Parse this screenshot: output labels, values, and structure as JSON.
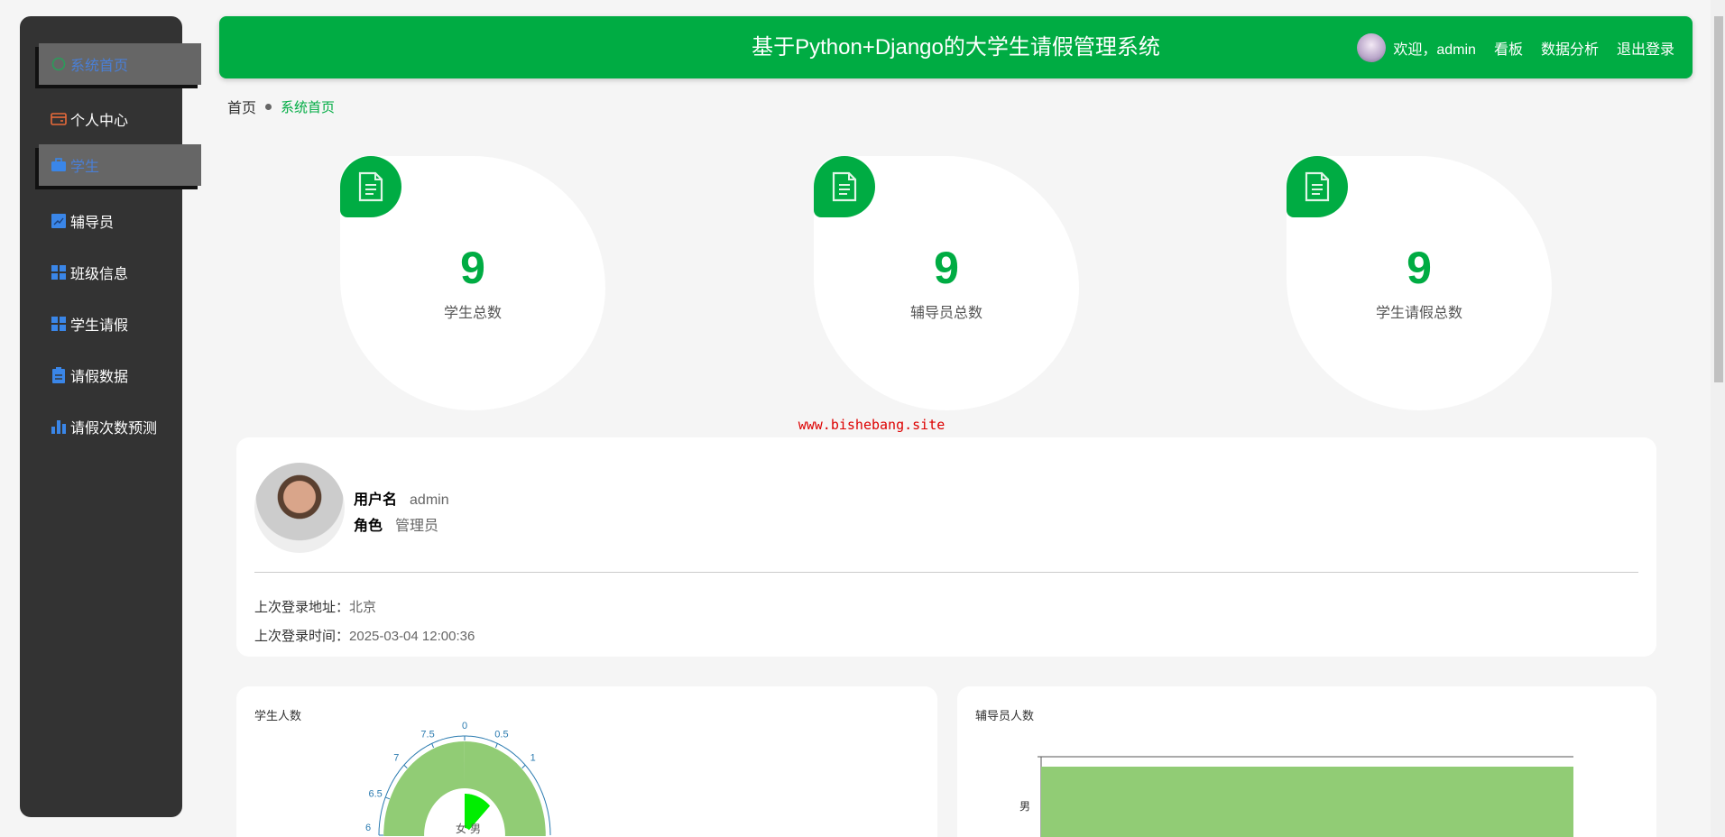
{
  "header": {
    "title": "基于Python+Django的大学生请假管理系统",
    "welcome": "欢迎，admin",
    "links": [
      "看板",
      "数据分析",
      "退出登录"
    ]
  },
  "sidebar": {
    "items": [
      {
        "label": "系统首页",
        "icon": "home-icon",
        "color": "#2a9d5a"
      },
      {
        "label": "个人中心",
        "icon": "wallet-icon",
        "color": "#e86a3a"
      },
      {
        "label": "学生",
        "icon": "briefcase-icon",
        "color": "#3a86e8"
      },
      {
        "label": "辅导员",
        "icon": "chart-line-icon",
        "color": "#3a86e8"
      },
      {
        "label": "班级信息",
        "icon": "grid-icon",
        "color": "#3a86e8"
      },
      {
        "label": "学生请假",
        "icon": "grid-icon",
        "color": "#3a86e8"
      },
      {
        "label": "请假数据",
        "icon": "clipboard-icon",
        "color": "#3a86e8"
      },
      {
        "label": "请假次数预测",
        "icon": "bar-chart-icon",
        "color": "#3a86e8"
      }
    ]
  },
  "breadcrumb": {
    "home": "首页",
    "current": "系统首页"
  },
  "stats": [
    {
      "value": "9",
      "label": "学生总数"
    },
    {
      "value": "9",
      "label": "辅导员总数"
    },
    {
      "value": "9",
      "label": "学生请假总数"
    }
  ],
  "watermark": "www.bishebang.site",
  "profile": {
    "username_label": "用户名",
    "username": "admin",
    "role_label": "角色",
    "role": "管理员",
    "last_addr_label": "上次登录地址：",
    "last_addr": "北京",
    "last_time_label": "上次登录时间：",
    "last_time": "2025-03-04 12:00:36"
  },
  "chart_data": [
    {
      "type": "polar-bar",
      "title": "学生人数",
      "angle_ticks": [
        "0",
        "0.5",
        "1",
        "6",
        "6.5",
        "7",
        "7.5"
      ],
      "angle_max": 8,
      "categories": [
        "男",
        "女"
      ],
      "values": [
        8,
        1
      ],
      "colors": [
        "#91cc75",
        "#00ee00"
      ]
    },
    {
      "type": "bar",
      "orientation": "horizontal",
      "title": "辅导员人数",
      "categories": [
        "男"
      ],
      "values": [
        9
      ],
      "color": "#91cc75"
    }
  ]
}
